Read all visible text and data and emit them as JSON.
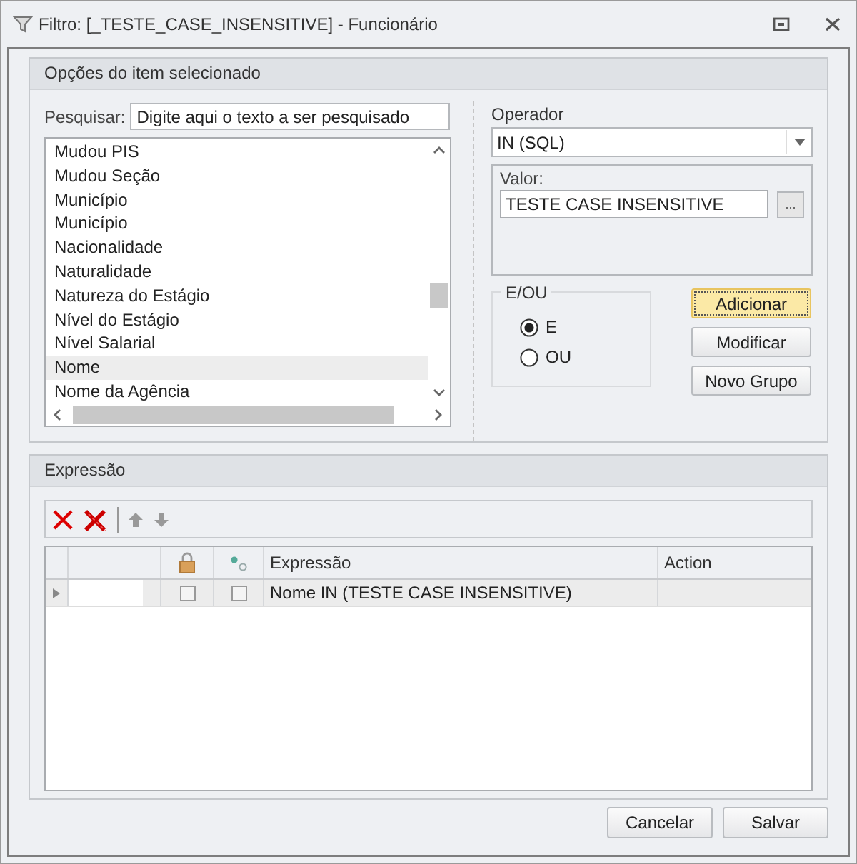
{
  "window": {
    "title": "Filtro: [_TESTE_CASE_INSENSITIVE] - Funcionário"
  },
  "options_panel": {
    "title": "Opções do item selecionado",
    "search": {
      "label": "Pesquisar:",
      "placeholder": "Digite aqui o texto a ser pesquisado"
    },
    "fields": [
      {
        "label": "Mudou PIS",
        "selected": false
      },
      {
        "label": "Mudou Seção",
        "selected": false
      },
      {
        "label": "Município",
        "selected": false
      },
      {
        "label": "Município",
        "selected": false
      },
      {
        "label": "Nacionalidade",
        "selected": false
      },
      {
        "label": "Naturalidade",
        "selected": false
      },
      {
        "label": "Natureza do Estágio",
        "selected": false
      },
      {
        "label": "Nível do Estágio",
        "selected": false
      },
      {
        "label": "Nível Salarial",
        "selected": false
      },
      {
        "label": "Nome",
        "selected": true
      },
      {
        "label": "Nome da Agência",
        "selected": false
      }
    ],
    "operator": {
      "label": "Operador",
      "value": "IN (SQL)"
    },
    "value_group": {
      "label": "Valor:",
      "value": "TESTE CASE INSENSITIVE",
      "browse": "..."
    },
    "logic_group": {
      "title": "E/OU",
      "options": [
        {
          "label": "E",
          "selected": true
        },
        {
          "label": "OU",
          "selected": false
        }
      ]
    },
    "buttons": [
      {
        "label": "Adicionar",
        "focused": true
      },
      {
        "label": "Modificar",
        "focused": false
      },
      {
        "label": "Novo Grupo",
        "focused": false
      }
    ]
  },
  "expression_panel": {
    "title": "Expressão",
    "grid": {
      "columns": [
        {
          "kind": "blank"
        },
        {
          "kind": "lock"
        },
        {
          "kind": "link"
        },
        {
          "kind": "text",
          "label": "Expressão"
        },
        {
          "kind": "text",
          "label": "Action"
        }
      ],
      "rows": [
        {
          "current": true,
          "locked": false,
          "linked": false,
          "expression": "Nome IN (TESTE CASE INSENSITIVE)"
        }
      ]
    }
  },
  "footer_buttons": [
    "Cancelar",
    "Salvar"
  ]
}
